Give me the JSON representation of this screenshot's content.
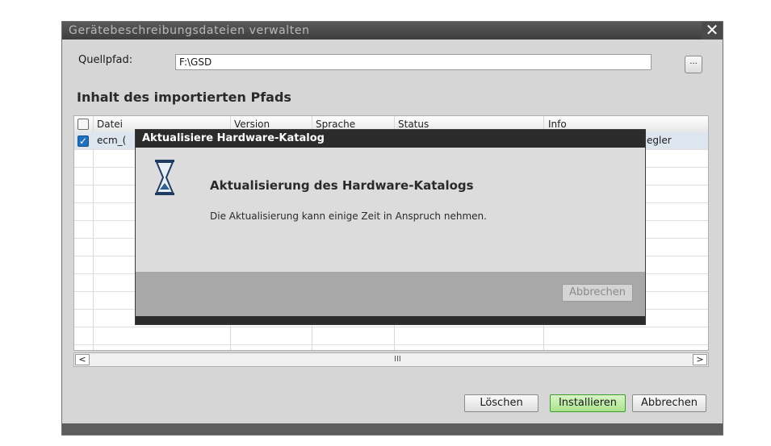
{
  "window": {
    "title": "Gerätebeschreibungsdateien verwalten",
    "close_label": "✕"
  },
  "source": {
    "label": "Quellpfad:",
    "value": "F:\\GSD",
    "browse_label": "..."
  },
  "section_title": "Inhalt des importierten Pfads",
  "table": {
    "columns": [
      "Datei",
      "Version",
      "Sprache",
      "Status",
      "Info"
    ],
    "rows": [
      {
        "checked": true,
        "file": "ecm_(",
        "info": "egler"
      }
    ]
  },
  "scrollbar": {
    "left_arrow": "<",
    "right_arrow": ">",
    "grip": "III"
  },
  "buttons": {
    "delete": "Löschen",
    "install": "Installieren",
    "cancel": "Abbrechen"
  },
  "progress_dialog": {
    "title": "Aktualisiere Hardware-Katalog",
    "heading": "Aktualisierung des Hardware-Katalogs",
    "message": "Die Aktualisierung kann einige Zeit in Anspruch nehmen.",
    "cancel_label": "Abbrechen",
    "icon": "hourglass-icon"
  }
}
